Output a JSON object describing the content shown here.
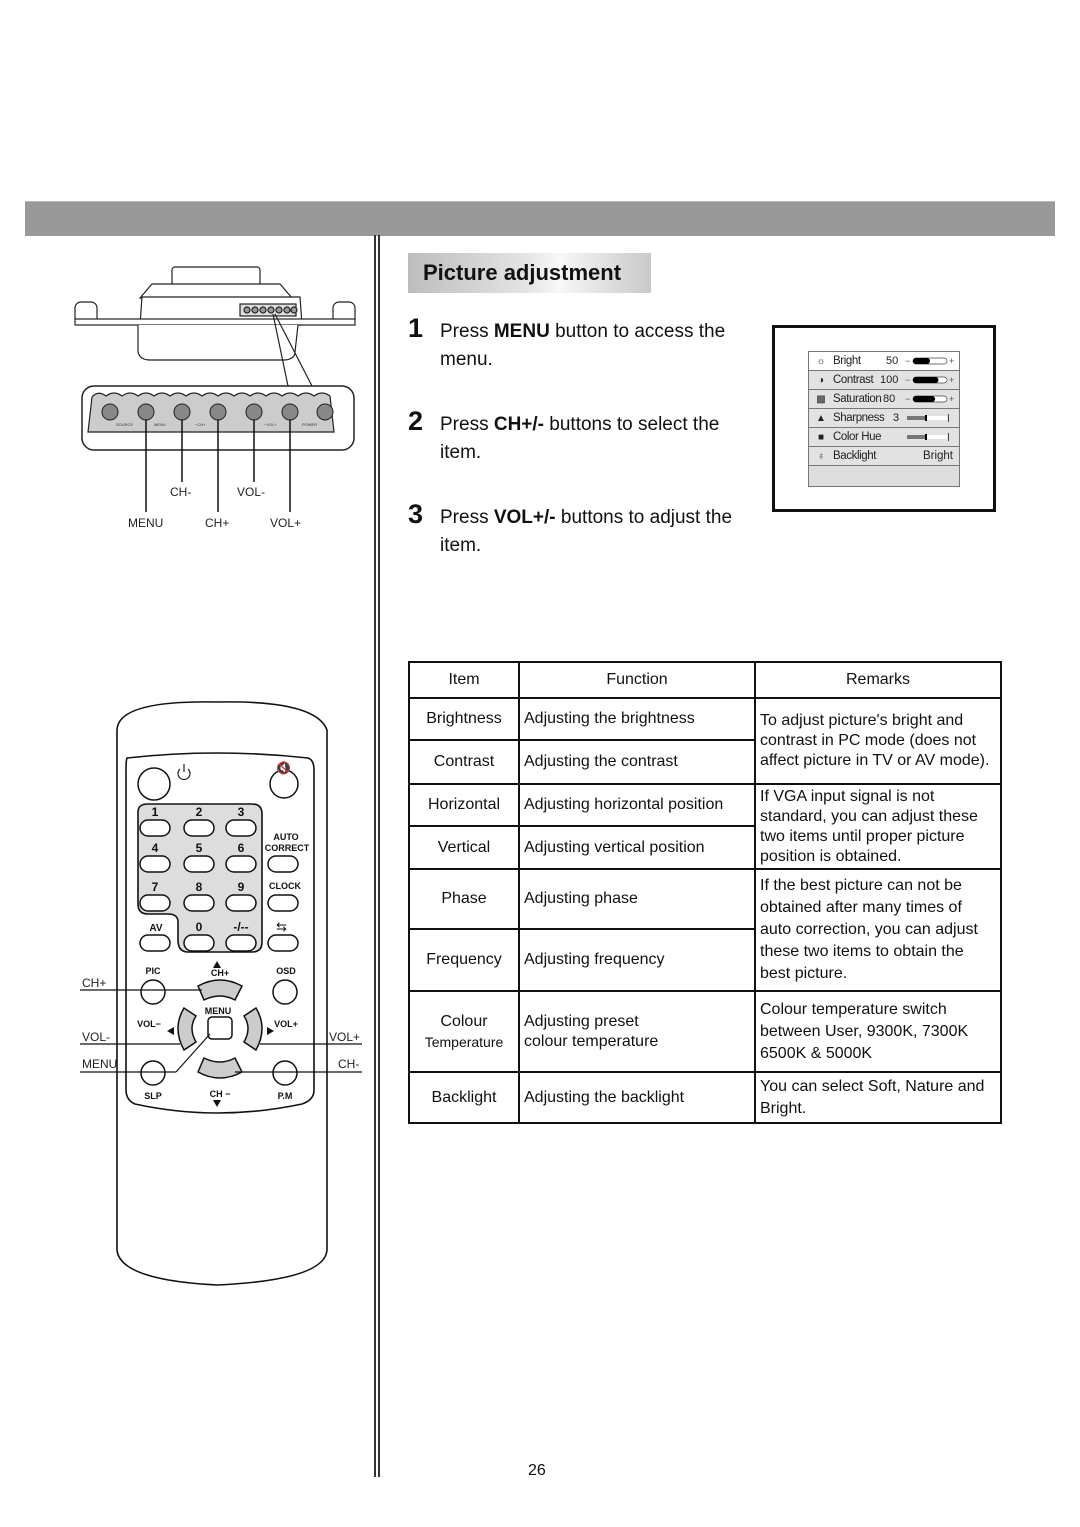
{
  "page": {
    "number": "26"
  },
  "section": {
    "title": "Picture adjustment"
  },
  "steps": [
    {
      "num": "1",
      "pre": "Press ",
      "bold": "MENU",
      "post": " button to access the menu."
    },
    {
      "num": "2",
      "pre": "Press ",
      "bold": "CH+/-",
      "post": " buttons to select the item."
    },
    {
      "num": "3",
      "pre": "Press ",
      "bold": "VOL+/-",
      "post": " buttons to adjust the item."
    }
  ],
  "osd_menu": {
    "items": [
      {
        "icon": "brightness-icon",
        "label": "Bright",
        "value": "50",
        "slider_percent": 50,
        "control": "slider"
      },
      {
        "icon": "contrast-icon",
        "label": "Contrast",
        "value": "100",
        "slider_percent": 75,
        "control": "slider"
      },
      {
        "icon": "saturation-icon",
        "label": "Saturation",
        "value": "80",
        "slider_percent": 65,
        "control": "slider"
      },
      {
        "icon": "sharpness-icon",
        "label": "Sharpness",
        "value": "3",
        "slider_percent": 50,
        "control": "step-slider"
      },
      {
        "icon": "color-hue-icon",
        "label": "Color Hue",
        "value": "",
        "slider_percent": 50,
        "control": "step-slider"
      },
      {
        "icon": "backlight-icon",
        "label": "Backlight",
        "value": "Bright",
        "control": "text"
      }
    ],
    "minus": "−",
    "plus": "+"
  },
  "monitor_panel": {
    "buttons": [
      "SOURCE",
      "MENU",
      "−CH+",
      "−VOL+",
      "POWER"
    ],
    "callouts": {
      "ch_minus": "CH-",
      "vol_minus": "VOL-",
      "menu": "MENU",
      "ch_plus": "CH+",
      "vol_plus": "VOL+"
    }
  },
  "remote": {
    "digits": [
      "1",
      "2",
      "3",
      "4",
      "5",
      "6",
      "7",
      "8",
      "9"
    ],
    "av": "AV",
    "zero": "0",
    "dash": "-/--",
    "auto_correct": [
      "AUTO",
      "CORRECT"
    ],
    "clock": "CLOCK",
    "pic": "PIC",
    "osd": "OSD",
    "ch_plus": "CH+",
    "ch_minus": "CH −",
    "menu": "MENU",
    "vol_minus": "VOL−",
    "vol_plus": "VOL+",
    "slp": "SLP",
    "pm": "P.M",
    "callouts": {
      "ch_plus": "CH+",
      "vol_minus": "VOL-",
      "menu": "MENU",
      "vol_plus": "VOL+",
      "ch_minus": "CH-"
    }
  },
  "table": {
    "headers": [
      "Item",
      "Function",
      "Remarks"
    ],
    "rows": [
      {
        "item": "Brightness",
        "function": "Adjusting the brightness"
      },
      {
        "item": "Contrast",
        "function": "Adjusting the contrast"
      },
      {
        "item": "Horizontal",
        "function": "Adjusting horizontal position"
      },
      {
        "item": "Vertical",
        "function": "Adjusting vertical position"
      },
      {
        "item": "Phase",
        "function": "Adjusting phase"
      },
      {
        "item": "Frequency",
        "function": "Adjusting frequency"
      },
      {
        "item": "Colour",
        "item_sub": "Temperature",
        "function": "Adjusting preset",
        "function_sub": "colour temperature"
      },
      {
        "item": "Backlight",
        "function": "Adjusting the backlight"
      }
    ],
    "remarks": [
      "To adjust picture's bright and contrast in PC mode (does not affect picture in TV or AV mode).",
      "If VGA input signal is not standard, you can adjust these two items until proper picture position is obtained.",
      "If the best picture can not be obtained after many times of auto correction, you can adjust these two items to obtain the best picture.",
      "Colour temperature switch between User, 9300K, 7300K 6500K & 5000K",
      "You can select Soft, Nature and Bright."
    ]
  }
}
